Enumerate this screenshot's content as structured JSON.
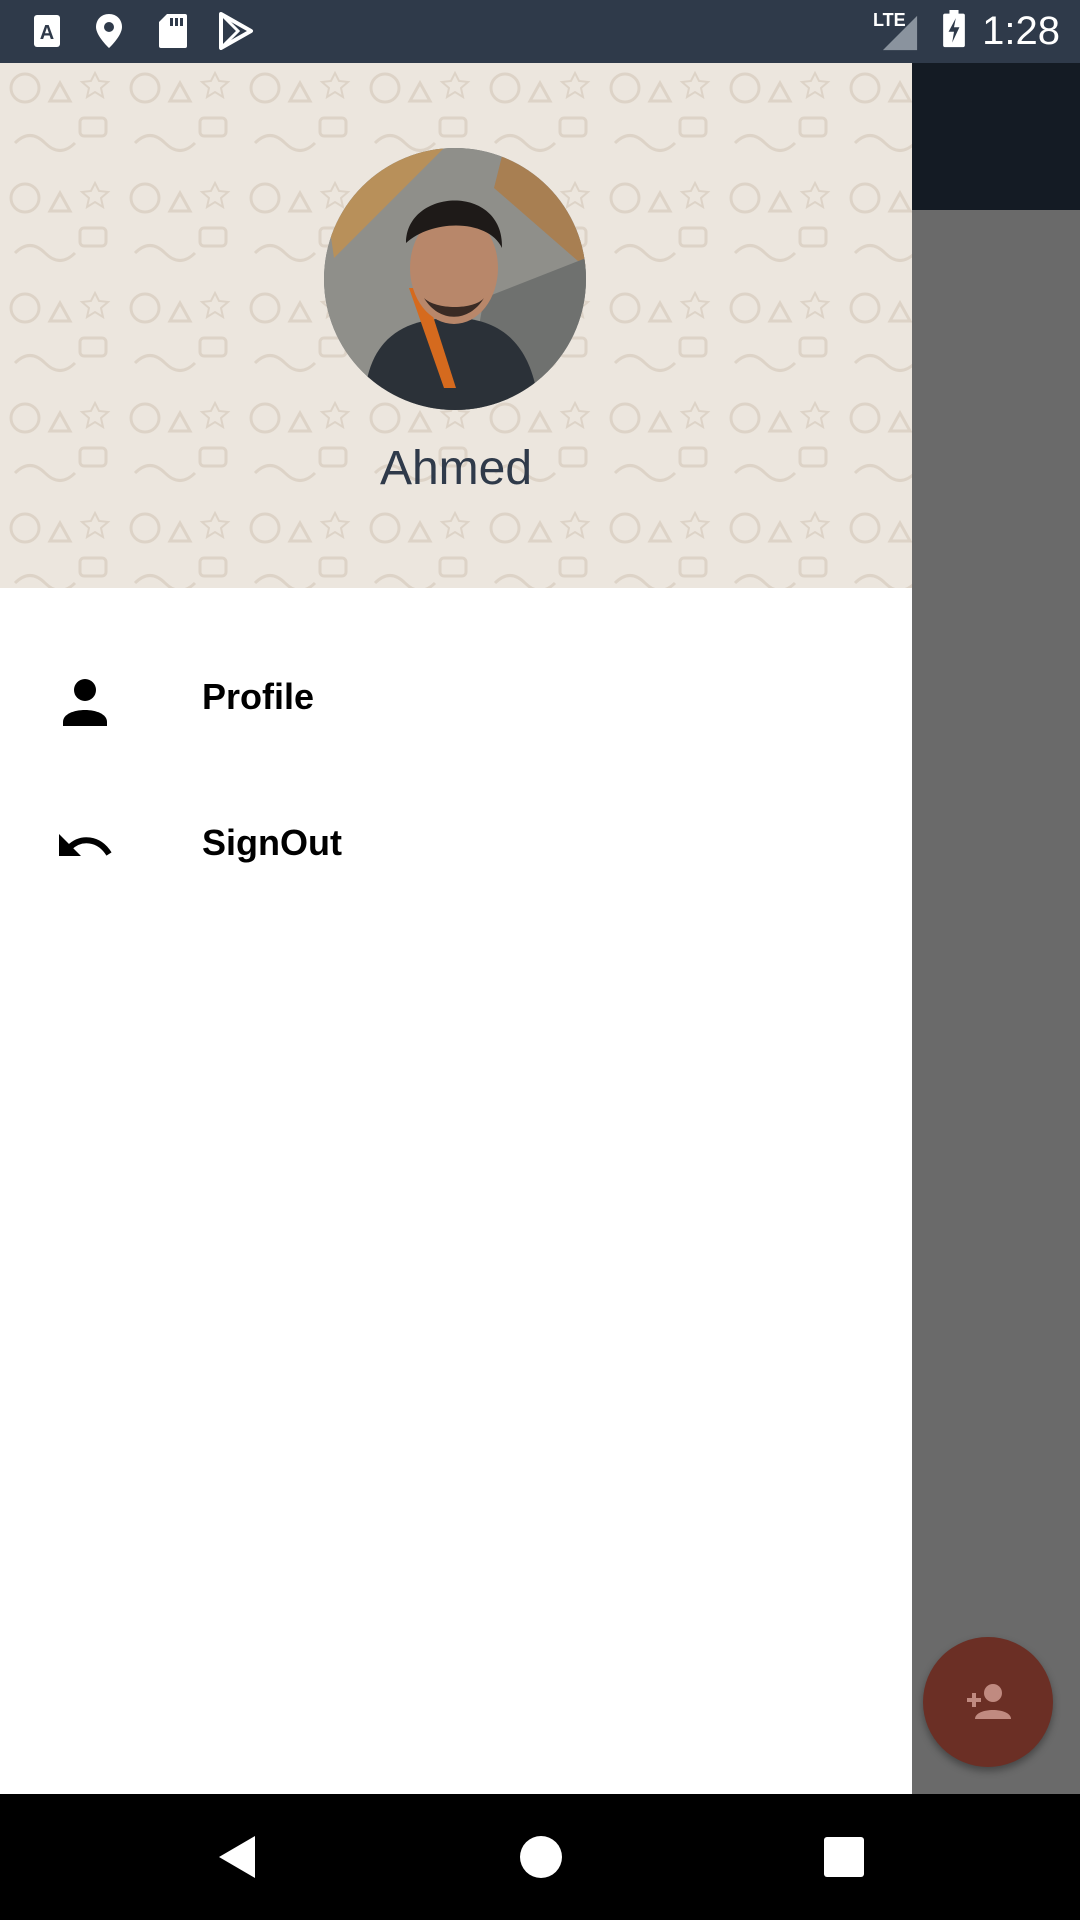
{
  "status_bar": {
    "time": "1:28",
    "network": "LTE",
    "left_icons": [
      "text-a-icon",
      "location-pin-icon",
      "sd-card-icon",
      "play-store-icon"
    ],
    "right_icons": [
      "signal-icon",
      "battery-charging-icon"
    ]
  },
  "drawer": {
    "header": {
      "user_name": "Ahmed"
    },
    "items": [
      {
        "label": "Profile",
        "icon": "person-icon"
      },
      {
        "label": "SignOut",
        "icon": "undo-arrow-icon"
      }
    ]
  },
  "fab": {
    "icon": "add-person-icon",
    "color": "#6b2f25"
  },
  "navigation_bar": {
    "buttons": [
      "back-icon",
      "home-icon",
      "recents-icon"
    ]
  },
  "colors": {
    "status_bar": "#2f3a4a",
    "toolbar": "#141b24",
    "scrim": "#6a6a6a",
    "header_bg": "#ece6de"
  }
}
